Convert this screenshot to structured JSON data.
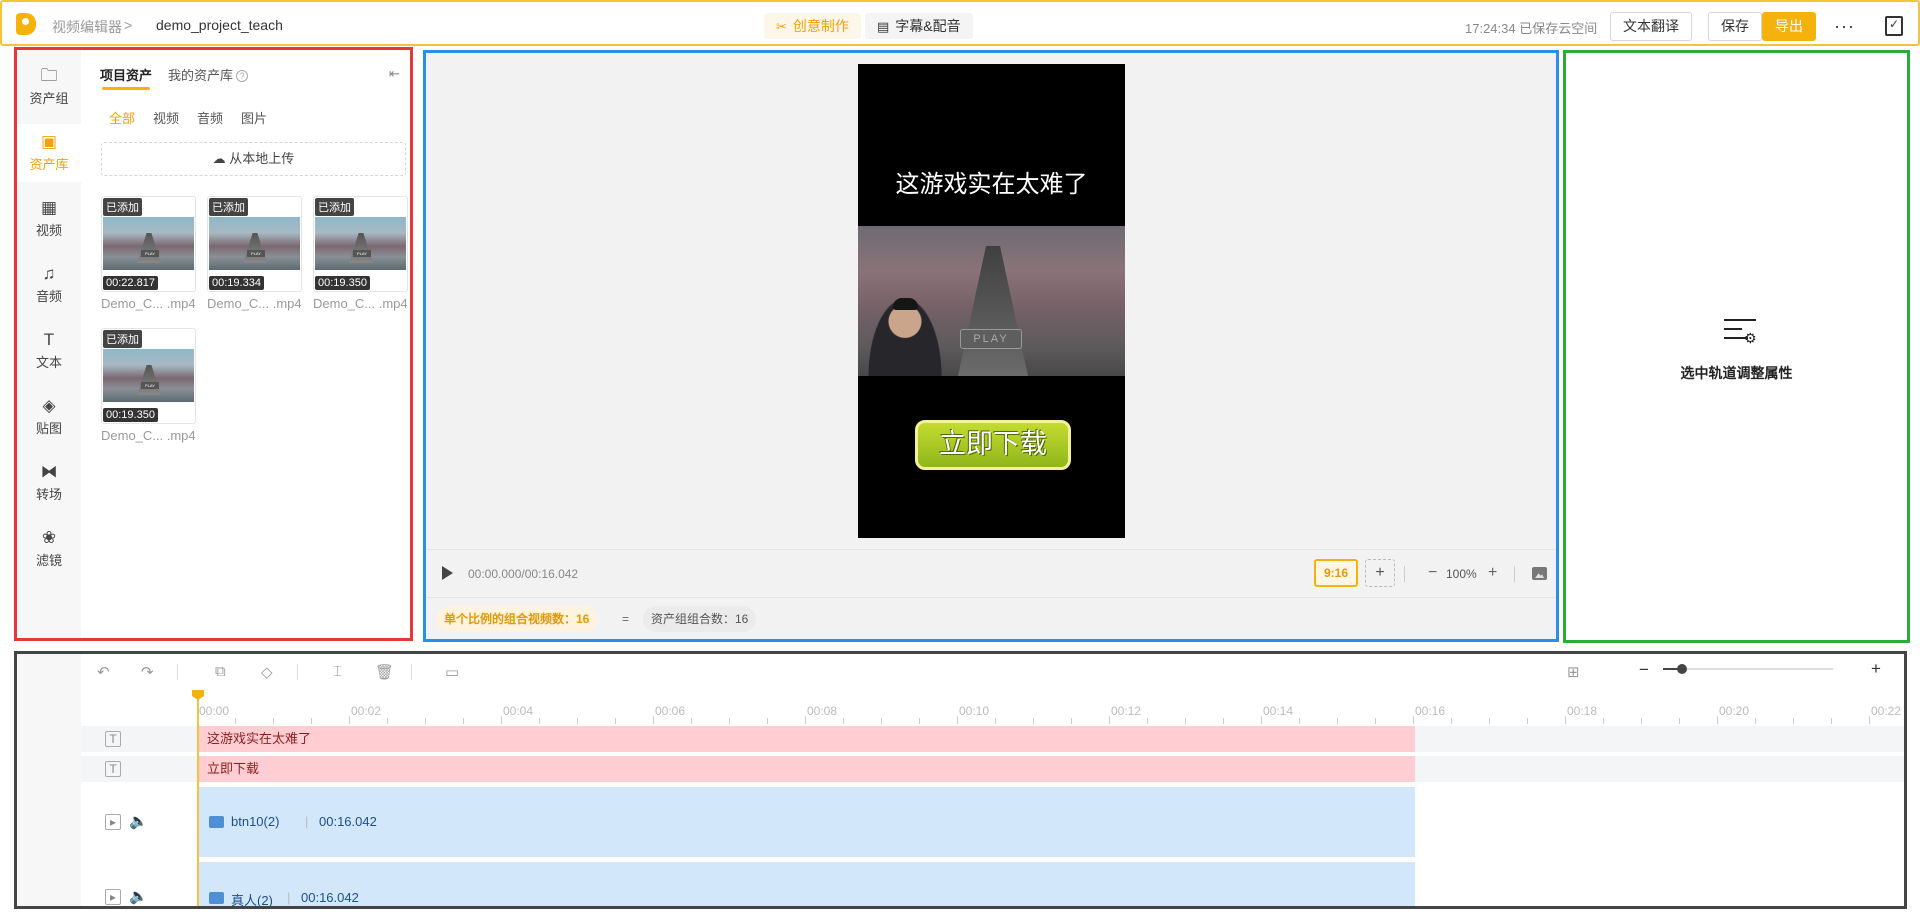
{
  "header": {
    "breadcrumb_root": "视频编辑器",
    "breadcrumb_sep": ">",
    "project_name": "demo_project_teach",
    "tab_create": "创意制作",
    "tab_subtitle": "字幕&配音",
    "save_status": "17:24:34 已保存云空间",
    "translate_label": "文本翻译",
    "save_label": "保存",
    "export_label": "导出",
    "more_label": "···",
    "accent_color": "#f5b10c"
  },
  "rail": {
    "items": [
      {
        "label": "资产组",
        "icon": "folder-icon",
        "glyph": "🗀"
      },
      {
        "label": "资产库",
        "icon": "media-library-icon",
        "glyph": "▣",
        "active": true
      },
      {
        "label": "视频",
        "icon": "film-icon",
        "glyph": "▦"
      },
      {
        "label": "音频",
        "icon": "music-icon",
        "glyph": "♫"
      },
      {
        "label": "文本",
        "icon": "text-icon",
        "glyph": "T"
      },
      {
        "label": "贴图",
        "icon": "sticker-icon",
        "glyph": "◈"
      },
      {
        "label": "转场",
        "icon": "transition-icon",
        "glyph": "⧓"
      },
      {
        "label": "滤镜",
        "icon": "filter-icon",
        "glyph": "❀"
      }
    ]
  },
  "assets_panel": {
    "tab_project": "项目资产",
    "tab_mine": "我的资产库",
    "help_glyph": "?",
    "filters": [
      "全部",
      "视频",
      "音频",
      "图片"
    ],
    "upload_label": "从本地上传",
    "items": [
      {
        "badge": "已添加",
        "duration": "00:22.817",
        "name": "Demo_C... .mp4"
      },
      {
        "badge": "已添加",
        "duration": "00:19.334",
        "name": "Demo_C... .mp4"
      },
      {
        "badge": "已添加",
        "duration": "00:19.350",
        "name": "Demo_C... .mp4"
      },
      {
        "badge": "已添加",
        "duration": "00:19.350",
        "name": "Demo_C... .mp4"
      }
    ]
  },
  "preview": {
    "caption": "这游戏实在太难了",
    "game_button": "PLAY",
    "download_button": "立即下载",
    "timecode": "00:00.000/00:16.042",
    "ratio": "9:16",
    "add_ratio": "+",
    "zoom_minus": "−",
    "zoom_value": "100%",
    "zoom_plus": "+",
    "stat_combos": "单个比例的组合视频数：16",
    "equals": "=",
    "stat_groups": "资产组组合数：16"
  },
  "properties": {
    "empty_hint": "选中轨道调整属性"
  },
  "timeline": {
    "ticks": [
      "00:00",
      "00:02",
      "00:04",
      "00:06",
      "00:08",
      "00:10",
      "00:12",
      "00:14",
      "00:16",
      "00:18",
      "00:20",
      "00:22"
    ],
    "tracks": [
      {
        "type": "text",
        "label": "这游戏实在太难了"
      },
      {
        "type": "text",
        "label": "立即下载"
      },
      {
        "type": "video",
        "label": "btn10(2)",
        "duration": "00:16.042"
      },
      {
        "type": "video",
        "label": "真人(2)",
        "duration": "00:16.042"
      }
    ],
    "zoom_minus": "−",
    "zoom_plus": "+"
  }
}
